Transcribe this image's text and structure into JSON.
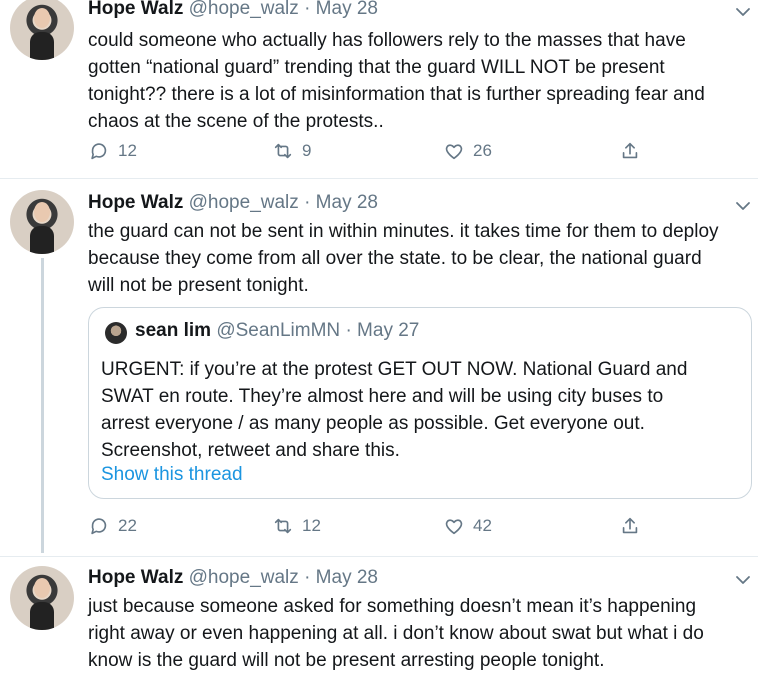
{
  "tweets": [
    {
      "name": "Hope Walz",
      "handle": "@hope_walz",
      "sep": "·",
      "date": "May 28",
      "lines": [
        "could someone who actually has followers rely to the masses that have",
        "gotten “national guard” trending that the guard WILL NOT be present",
        "tonight?? there is a lot of misinformation that is further spreading fear and",
        "chaos at the scene of the protests.."
      ],
      "replies": "12",
      "retweets": "9",
      "likes": "26"
    },
    {
      "name": "Hope Walz",
      "handle": "@hope_walz",
      "sep": "·",
      "date": "May 28",
      "lines": [
        "the guard can not be sent in within minutes. it takes time for them to deploy",
        "because they come from all over the state. to be clear, the national guard",
        "will not be present tonight."
      ],
      "quote": {
        "name": "sean lim",
        "handle": "@SeanLimMN",
        "sep": "·",
        "date": "May 27",
        "lines": [
          "URGENT: if you’re at the protest GET OUT NOW. National Guard and",
          "SWAT en route. They’re almost here and will be using city buses to",
          "arrest everyone / as many people as possible. Get everyone out.",
          "Screenshot, retweet and share this."
        ],
        "link": "Show this thread"
      },
      "replies": "22",
      "retweets": "12",
      "likes": "42"
    },
    {
      "name": "Hope Walz",
      "handle": "@hope_walz",
      "sep": "·",
      "date": "May 28",
      "lines": [
        "just because someone asked for something doesn’t mean it’s happening",
        "right away or even happening at all. i don’t know about swat but what i do",
        "know is the guard will not be present arresting people tonight."
      ]
    }
  ],
  "icons": {
    "reply": "reply-icon",
    "retweet": "retweet-icon",
    "like": "heart-icon",
    "share": "share-icon",
    "menu": "chevron-down-icon"
  },
  "colors": {
    "text": "#14171a",
    "muted": "#657786",
    "link": "#1b95e0",
    "border": "#ccd6dd"
  }
}
